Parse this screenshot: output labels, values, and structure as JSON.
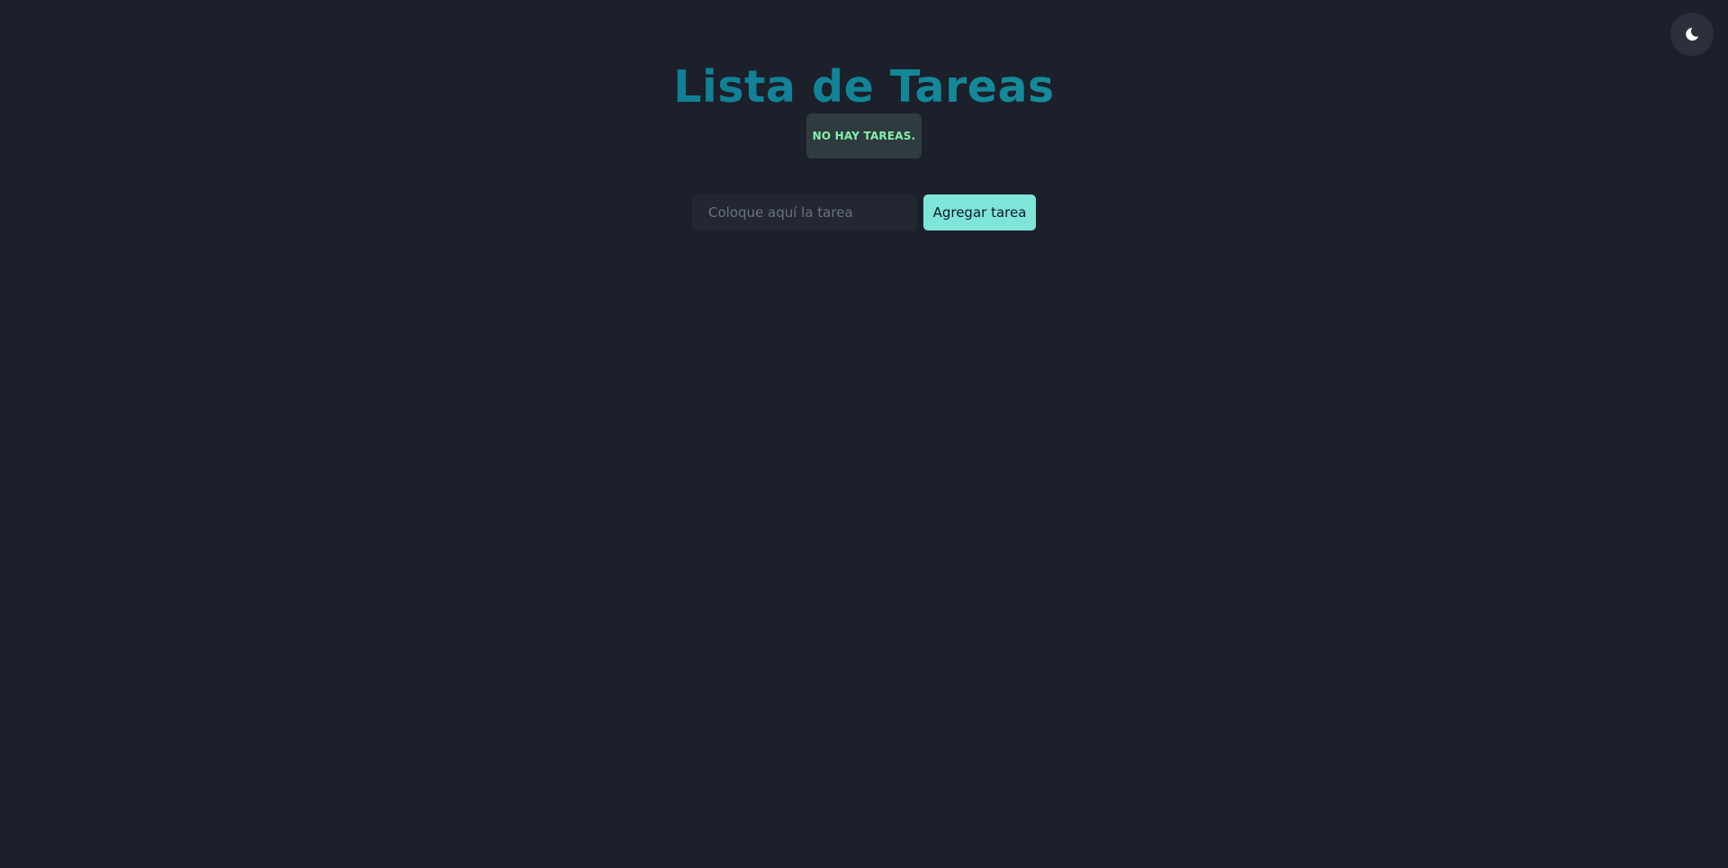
{
  "header": {
    "title": "Lista de Tareas",
    "theme_toggle_icon": "moon-icon"
  },
  "status": {
    "empty_message": "NO HAY TAREAS."
  },
  "form": {
    "input_value": "",
    "input_placeholder": "Coloque aquí la tarea",
    "add_button_label": "Agregar tarea"
  },
  "colors": {
    "background": "#1b202b",
    "accent": "#7ee5d8",
    "title_gradient_start": "#0e7490",
    "title_gradient_end": "#21a1a0",
    "status_text": "#86efac"
  },
  "tasks": []
}
